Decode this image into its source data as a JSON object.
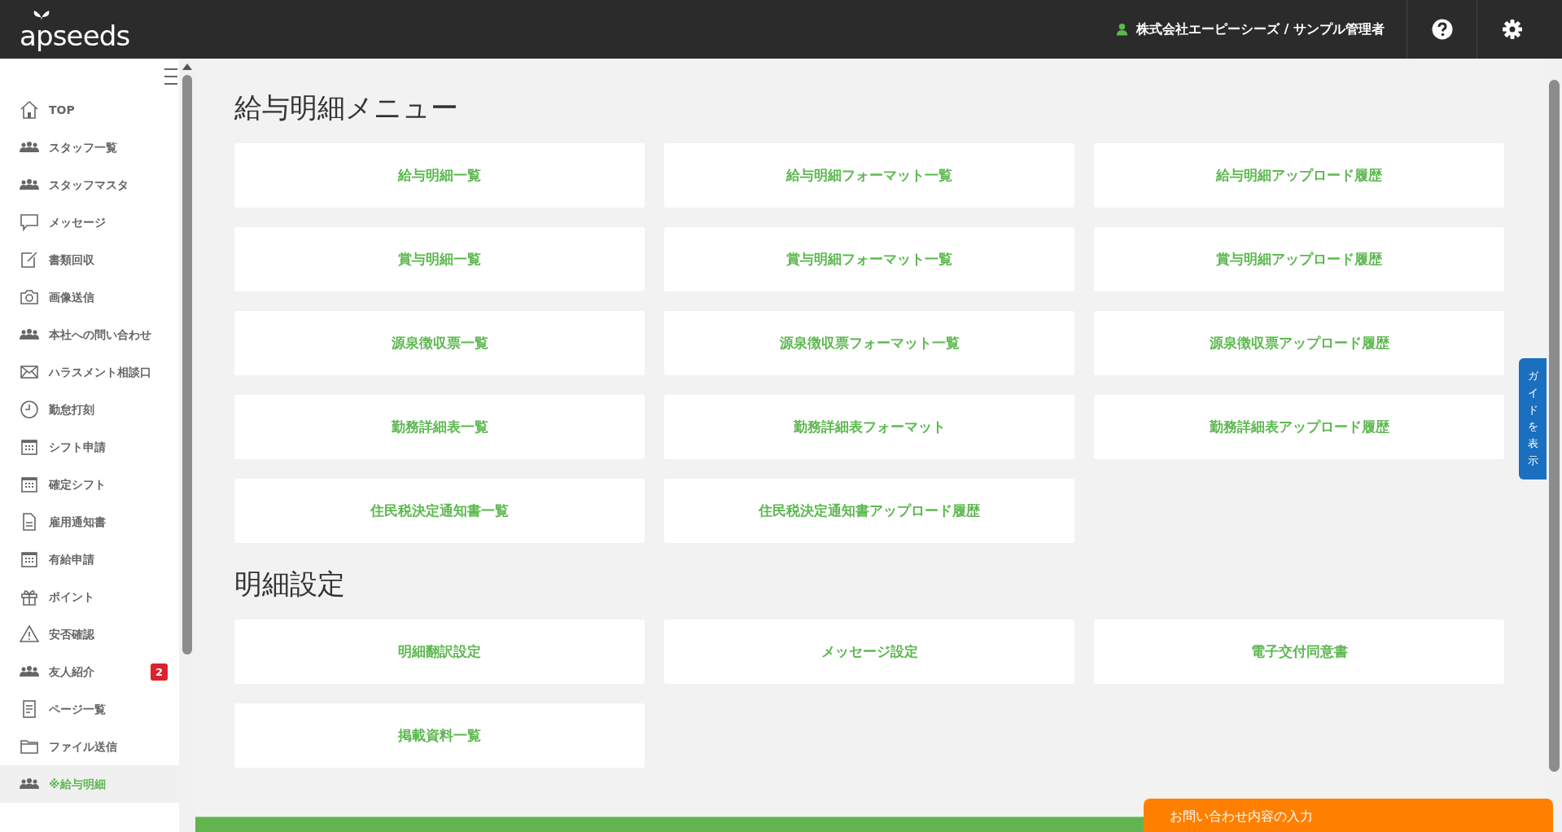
{
  "header": {
    "logo": "apseeds",
    "user": "株式会社エーピーシーズ / サンプル管理者"
  },
  "sidebar": {
    "items": [
      {
        "label": "TOP",
        "kind": "home",
        "selected": false
      },
      {
        "label": "スタッフ一覧",
        "kind": "people",
        "selected": false
      },
      {
        "label": "スタッフマスタ",
        "kind": "people",
        "selected": false
      },
      {
        "label": "メッセージ",
        "kind": "chat",
        "selected": false
      },
      {
        "label": "書類回収",
        "kind": "edit",
        "selected": false
      },
      {
        "label": "画像送信",
        "kind": "camera",
        "selected": false
      },
      {
        "label": "本社への問い合わせ",
        "kind": "people",
        "selected": false
      },
      {
        "label": "ハラスメント相談口",
        "kind": "mail",
        "selected": false
      },
      {
        "label": "勤怠打刻",
        "kind": "clock",
        "selected": false
      },
      {
        "label": "シフト申請",
        "kind": "calendar",
        "selected": false
      },
      {
        "label": "確定シフト",
        "kind": "calendar",
        "selected": false
      },
      {
        "label": "雇用通知書",
        "kind": "doc",
        "selected": false
      },
      {
        "label": "有給申請",
        "kind": "calendar",
        "selected": false
      },
      {
        "label": "ポイント",
        "kind": "gift",
        "selected": false
      },
      {
        "label": "安否確認",
        "kind": "warning",
        "selected": false
      },
      {
        "label": "友人紹介",
        "kind": "people",
        "selected": false,
        "badge": "2"
      },
      {
        "label": "ページ一覧",
        "kind": "page",
        "selected": false
      },
      {
        "label": "ファイル送信",
        "kind": "folder",
        "selected": false
      },
      {
        "label": "※給与明細",
        "kind": "people",
        "selected": true
      }
    ]
  },
  "sections": [
    {
      "title": "給与明細メニュー",
      "buttons": [
        "給与明細一覧",
        "給与明細フォーマット一覧",
        "給与明細アップロード履歴",
        "賞与明細一覧",
        "賞与明細フォーマット一覧",
        "賞与明細アップロード履歴",
        "源泉徴収票一覧",
        "源泉徴収票フォーマット一覧",
        "源泉徴収票アップロード履歴",
        "勤務詳細表一覧",
        "勤務詳細表フォーマット",
        "勤務詳細表アップロード履歴",
        "住民税決定通知書一覧",
        "住民税決定通知書アップロード履歴"
      ]
    },
    {
      "title": "明細設定",
      "buttons": [
        "明細翻訳設定",
        "メッセージ設定",
        "電子交付同意書",
        "掲載資料一覧"
      ]
    }
  ],
  "guide_tab": "ガイドを表示",
  "contact_tab": "お問い合わせ内容の入力"
}
